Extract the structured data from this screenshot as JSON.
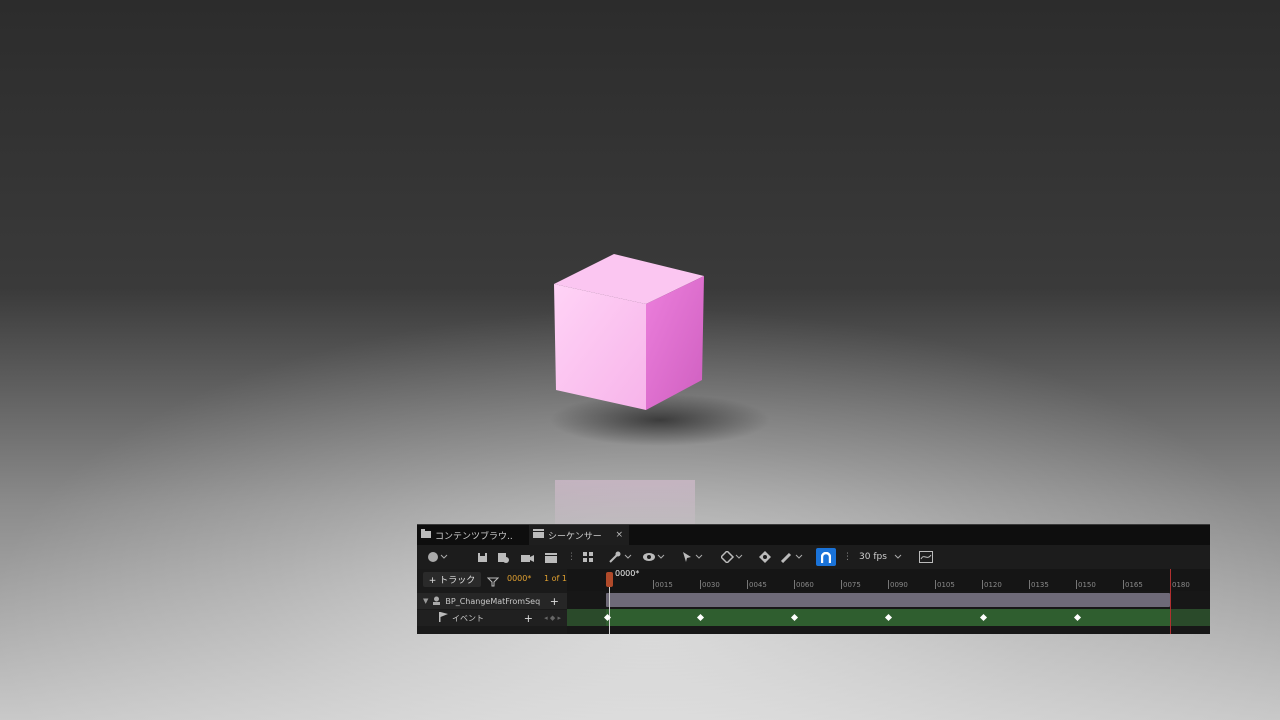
{
  "viewport": {
    "cube_color": "#f5b8ea",
    "background_color": "#3a3a3a"
  },
  "tabs": [
    {
      "label": "コンテンツブラウ.."
    },
    {
      "label": "シーケンサー"
    }
  ],
  "tab_close": "×",
  "toolbar": {
    "fps_label": "30 fps",
    "snap_color": "#1a73d9"
  },
  "outliner": {
    "add_track_label": "+ トラック",
    "current_frame": "0000*",
    "page_indicator": "1 of 1",
    "actor_label": "BP_ChangeMatFromSeq",
    "event_label": "イベント",
    "add_symbol": "+"
  },
  "timeline": {
    "playhead_label": "0000*",
    "ticks": [
      "0015",
      "0030",
      "0045",
      "0060",
      "0075",
      "0090",
      "0105",
      "0120",
      "0135",
      "0150",
      "0165",
      "0180"
    ],
    "section_colors": {
      "actor": "#6e6a78",
      "event": "#2f5e2f"
    }
  }
}
